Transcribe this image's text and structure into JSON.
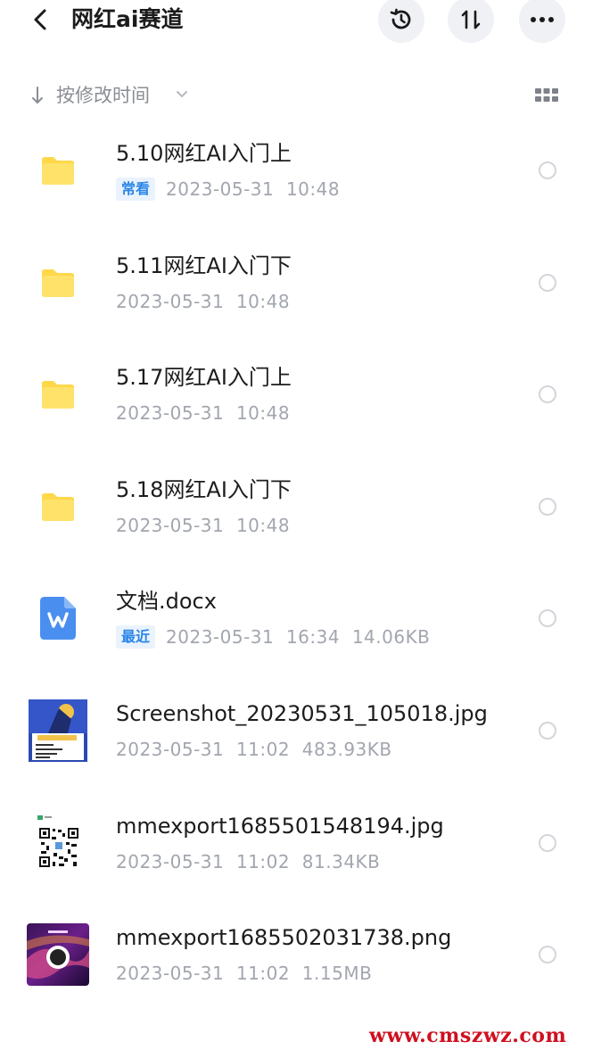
{
  "header": {
    "title": "网红ai赛道",
    "icons": [
      "back-icon",
      "history-icon",
      "sort-icon",
      "more-icon"
    ]
  },
  "sort": {
    "label": "按修改时间"
  },
  "files": [
    {
      "type": "folder",
      "name": "5.10网红AI入门上",
      "badge": "常看",
      "meta": "2023-05-31  10:48"
    },
    {
      "type": "folder",
      "name": "5.11网红AI入门下",
      "badge": "",
      "meta": "2023-05-31  10:48"
    },
    {
      "type": "folder",
      "name": "5.17网红AI入门上",
      "badge": "",
      "meta": "2023-05-31  10:48"
    },
    {
      "type": "folder",
      "name": "5.18网红AI入门下",
      "badge": "",
      "meta": "2023-05-31  10:48"
    },
    {
      "type": "docx",
      "name": "文档.docx",
      "badge": "最近",
      "meta": "2023-05-31  16:34  14.06KB"
    },
    {
      "type": "image",
      "name": "Screenshot_20230531_105018.jpg",
      "badge": "",
      "meta": "2023-05-31  11:02  483.93KB"
    },
    {
      "type": "image",
      "name": "mmexport1685501548194.jpg",
      "badge": "",
      "meta": "2023-05-31  11:02  81.34KB"
    },
    {
      "type": "image",
      "name": "mmexport1685502031738.png",
      "badge": "",
      "meta": "2023-05-31  11:02  1.15MB"
    }
  ],
  "watermark": "www.cmszwz.com",
  "colors": {
    "folder": "#ffd84a",
    "accent": "#2a86e8",
    "meta": "#a2a6ae"
  }
}
